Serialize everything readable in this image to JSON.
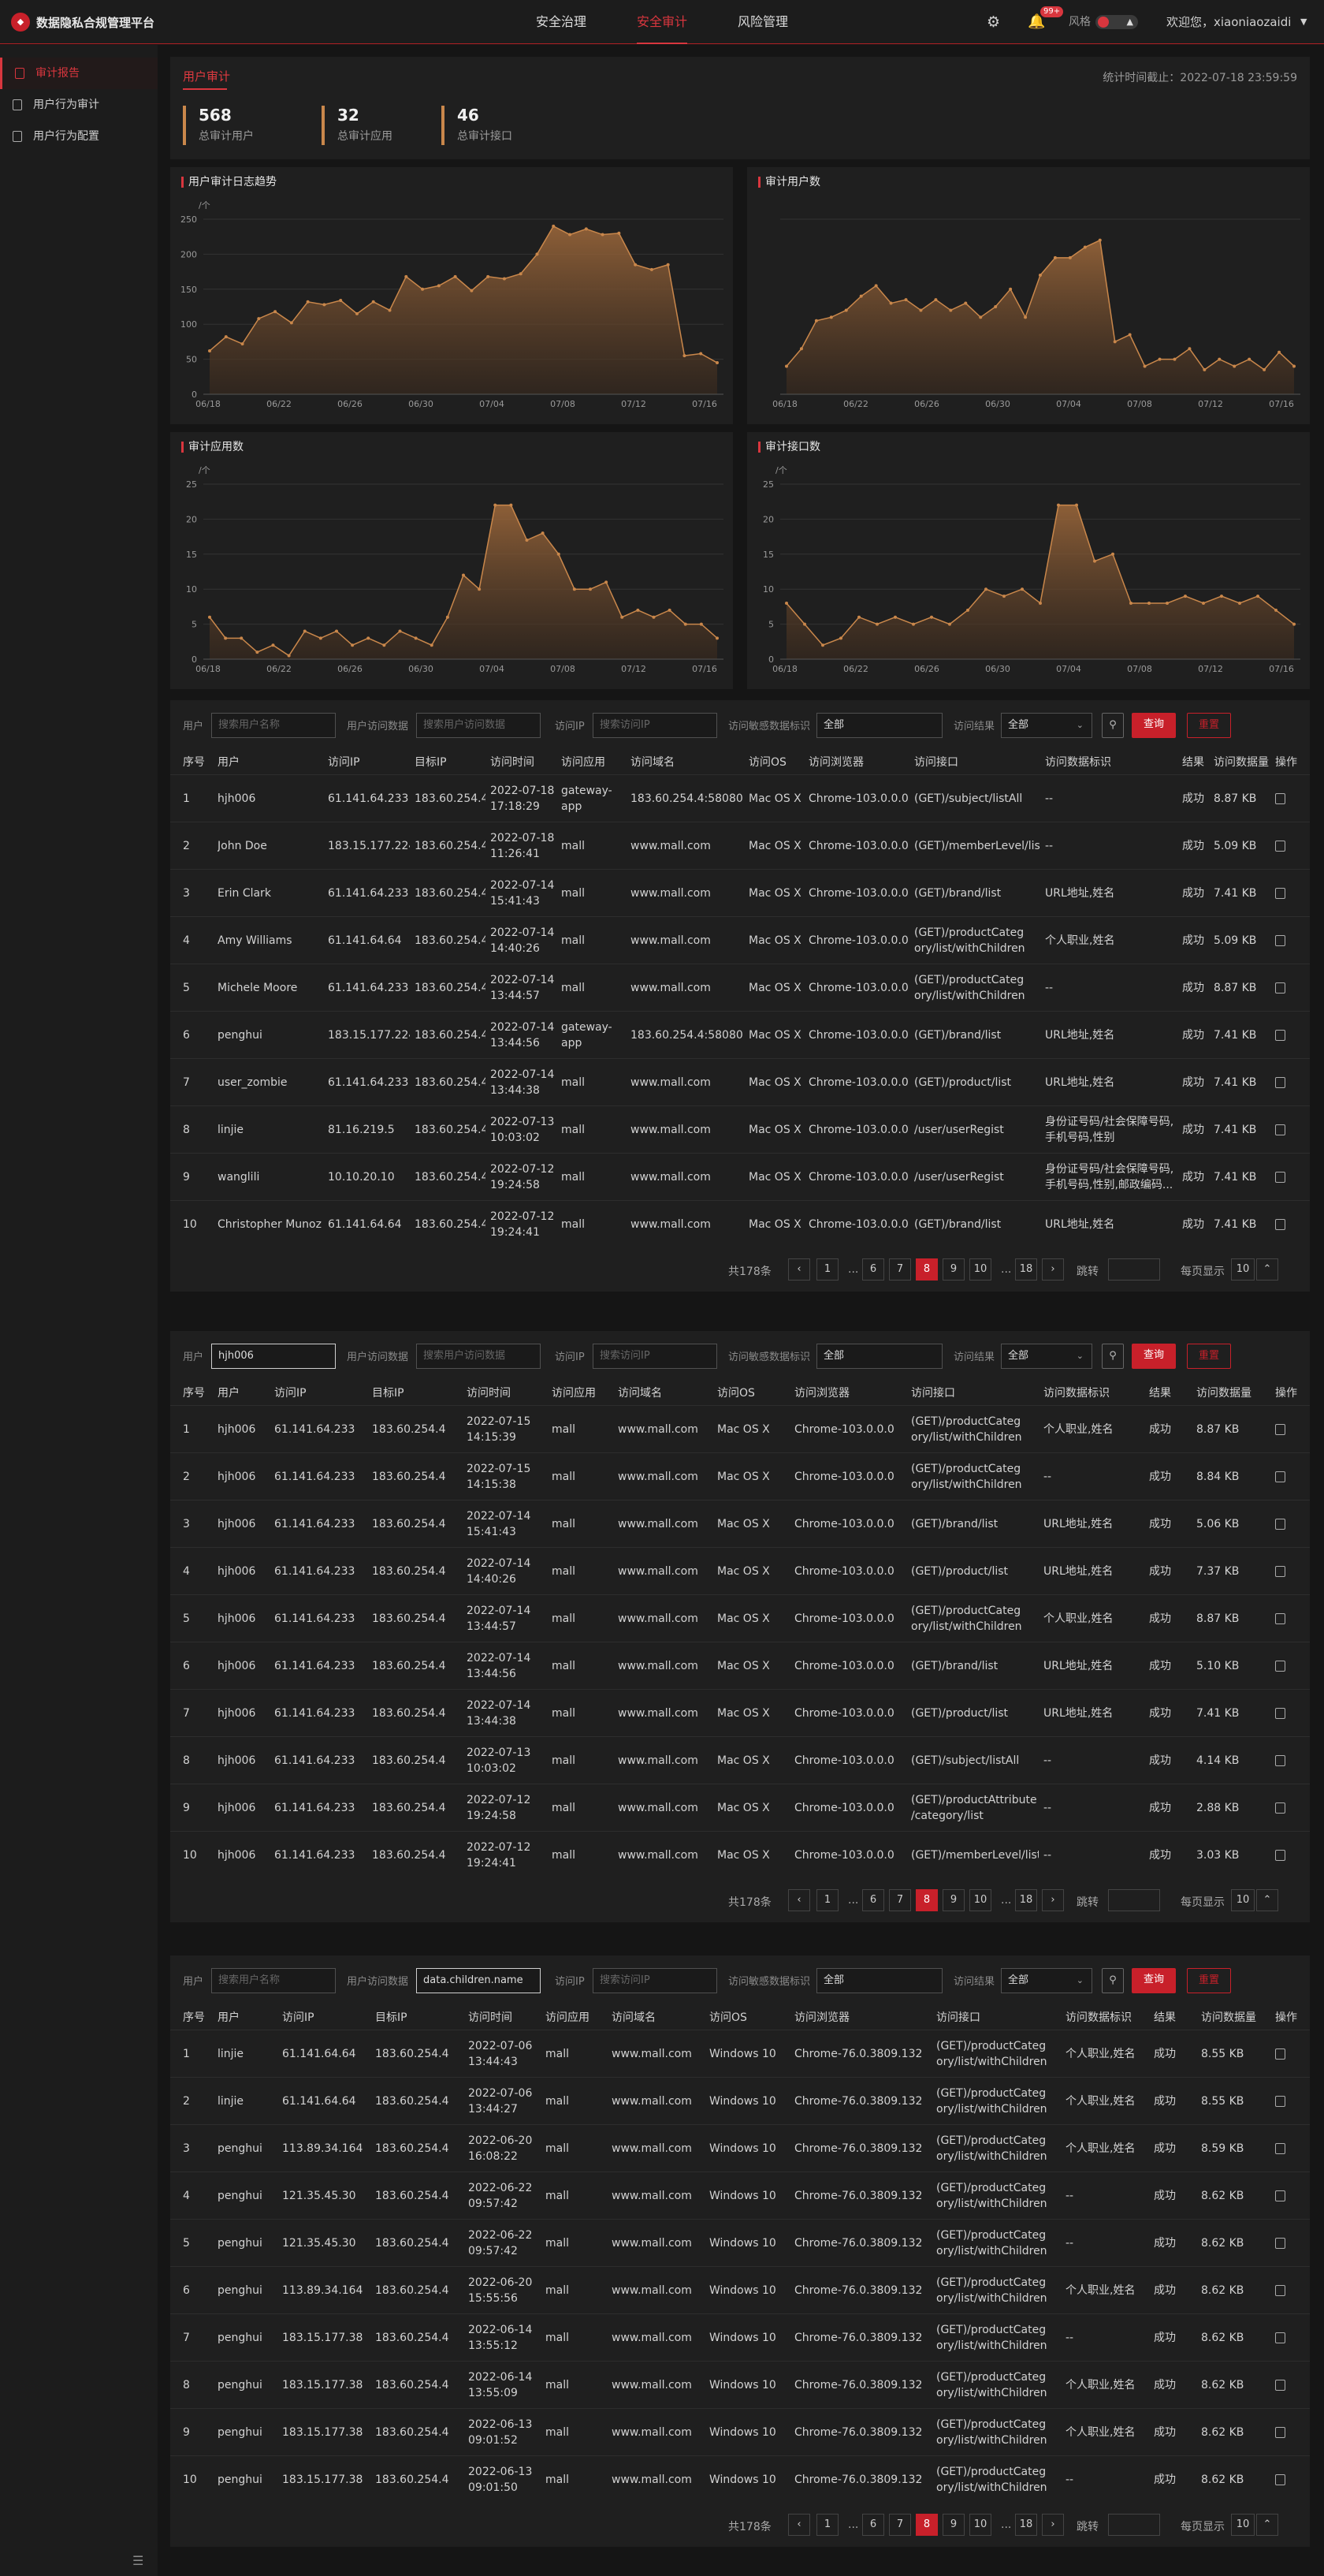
{
  "header": {
    "app_name": "数据隐私合规管理平台",
    "nav": [
      "安全治理",
      "安全审计",
      "风险管理"
    ],
    "badge": "99+",
    "style_label": "风格",
    "welcome": "欢迎您，xiaoniaozaidi"
  },
  "sidebar": {
    "items": [
      "审计报告",
      "用户行为审计",
      "用户行为配置"
    ]
  },
  "summary": {
    "title": "用户审计",
    "stamp": "统计时间截止：2022-07-18 23:59:59",
    "stats": [
      {
        "value": "568",
        "label": "总审计用户"
      },
      {
        "value": "32",
        "label": "总审计应用"
      },
      {
        "value": "46",
        "label": "总审计接口"
      }
    ]
  },
  "chart_data": [
    {
      "type": "area",
      "title": "用户审计日志趋势",
      "ylabel": "/个",
      "ylim": [
        0,
        250
      ],
      "yticks": [
        0,
        50,
        100,
        150,
        200,
        250
      ],
      "xticks": [
        "06/18",
        "06/22",
        "06/26",
        "06/30",
        "07/04",
        "07/08",
        "07/12",
        "07/16"
      ],
      "x_start": "06/17",
      "x_end": "07/17",
      "values": [
        62,
        82,
        72,
        108,
        118,
        102,
        132,
        128,
        134,
        115,
        132,
        120,
        168,
        150,
        155,
        168,
        148,
        168,
        165,
        172,
        200,
        240,
        228,
        236,
        228,
        230,
        185,
        178,
        185,
        55,
        58,
        45
      ]
    },
    {
      "type": "area",
      "title": "审计用户数",
      "ylabel": "",
      "ylim": [
        0,
        50
      ],
      "yticks": [],
      "xticks": [
        "06/18",
        "06/22",
        "06/26",
        "06/30",
        "07/04",
        "07/08",
        "07/12",
        "07/16"
      ],
      "x_start": "06/17",
      "x_end": "07/17",
      "values": [
        8,
        13,
        21,
        22,
        24,
        28,
        31,
        26,
        27,
        24,
        27,
        24,
        26,
        22,
        25,
        30,
        22,
        34,
        39,
        39,
        42,
        44,
        15,
        17,
        8,
        10,
        10,
        13,
        7,
        10,
        8,
        10,
        7,
        12,
        8
      ]
    },
    {
      "type": "area",
      "title": "审计应用数",
      "ylabel": "/个",
      "ylim": [
        0,
        25
      ],
      "yticks": [
        0,
        5,
        10,
        15,
        20,
        25
      ],
      "xticks": [
        "06/18",
        "06/22",
        "06/26",
        "06/30",
        "07/04",
        "07/08",
        "07/12",
        "07/16"
      ],
      "x_start": "06/17",
      "x_end": "07/17",
      "values": [
        6,
        3,
        3,
        1,
        2,
        0.5,
        4,
        3,
        4,
        2,
        3,
        2,
        4,
        3,
        2,
        6,
        12,
        10,
        22,
        22,
        17,
        18,
        15,
        10,
        10,
        11,
        6,
        7,
        6,
        7,
        5,
        5,
        3
      ]
    },
    {
      "type": "area",
      "title": "审计接口数",
      "ylabel": "/个",
      "ylim": [
        0,
        25
      ],
      "yticks": [
        0,
        5,
        10,
        15,
        20,
        25
      ],
      "xticks": [
        "06/18",
        "06/22",
        "06/26",
        "06/30",
        "07/04",
        "07/08",
        "07/12",
        "07/16"
      ],
      "x_start": "06/17",
      "x_end": "07/17",
      "values": [
        8,
        5,
        2,
        3,
        6,
        5,
        6,
        5,
        6,
        5,
        7,
        10,
        9,
        10,
        8,
        22,
        22,
        14,
        15,
        8,
        8,
        8,
        9,
        8,
        9,
        8,
        9,
        7,
        5
      ]
    }
  ],
  "tables": [
    {
      "filters": {
        "user_label": "用户",
        "user_placeholder": "搜索用户名称",
        "user_value": "",
        "data_label": "用户访问数据",
        "data_placeholder": "搜索用户访问数据",
        "data_value": "",
        "ip_label": "访问IP",
        "ip_placeholder": "搜索访问IP",
        "sens_label": "访问敏感数据标识",
        "sens_value": "全部",
        "result_label": "访问结果",
        "result_value": "全部",
        "query": "查询",
        "reset": "重置"
      },
      "columns": [
        "序号",
        "用户",
        "访问IP",
        "目标IP",
        "访问时间",
        "访问应用",
        "访问域名",
        "访问OS",
        "访问浏览器",
        "访问接口",
        "访问数据标识",
        "结果",
        "访问数据量",
        "操作"
      ],
      "rows": [
        [
          "1",
          "hjh006",
          "61.141.64.233",
          "183.60.254.4",
          "2022-07-18 17:18:29",
          "gateway-app",
          "183.60.254.4:58080",
          "Mac OS X",
          "Chrome-103.0.0.0",
          "(GET)/subject/listAll",
          "--",
          "成功",
          "8.87 KB"
        ],
        [
          "2",
          "John Doe",
          "183.15.177.224",
          "183.60.254.4",
          "2022-07-18 11:26:41",
          "mall",
          "www.mall.com",
          "Mac OS X",
          "Chrome-103.0.0.0",
          "(GET)/memberLevel/list",
          "--",
          "成功",
          "5.09 KB"
        ],
        [
          "3",
          "Erin Clark",
          "61.141.64.233",
          "183.60.254.4",
          "2022-07-14 15:41:43",
          "mall",
          "www.mall.com",
          "Mac OS X",
          "Chrome-103.0.0.0",
          "(GET)/brand/list",
          "URL地址,姓名",
          "成功",
          "7.41 KB"
        ],
        [
          "4",
          "Amy Williams",
          "61.141.64.64",
          "183.60.254.4",
          "2022-07-14 14:40:26",
          "mall",
          "www.mall.com",
          "Mac OS X",
          "Chrome-103.0.0.0",
          "(GET)/productCateg ory/list/withChildren",
          "个人职业,姓名",
          "成功",
          "5.09 KB"
        ],
        [
          "5",
          "Michele Moore",
          "61.141.64.233",
          "183.60.254.4",
          "2022-07-14 13:44:57",
          "mall",
          "www.mall.com",
          "Mac OS X",
          "Chrome-103.0.0.0",
          "(GET)/productCateg ory/list/withChildren",
          "--",
          "成功",
          "8.87 KB"
        ],
        [
          "6",
          "penghui",
          "183.15.177.224",
          "183.60.254.4",
          "2022-07-14 13:44:56",
          "gateway-app",
          "183.60.254.4:58080",
          "Mac OS X",
          "Chrome-103.0.0.0",
          "(GET)/brand/list",
          "URL地址,姓名",
          "成功",
          "7.41 KB"
        ],
        [
          "7",
          "user_zombie",
          "61.141.64.233",
          "183.60.254.4",
          "2022-07-14 13:44:38",
          "mall",
          "www.mall.com",
          "Mac OS X",
          "Chrome-103.0.0.0",
          "(GET)/product/list",
          "URL地址,姓名",
          "成功",
          "7.41 KB"
        ],
        [
          "8",
          "linjie",
          "81.16.219.5",
          "183.60.254.4",
          "2022-07-13 10:03:02",
          "mall",
          "www.mall.com",
          "Mac OS X",
          "Chrome-103.0.0.0",
          "/user/userRegist",
          "身份证号码/社会保障号码,手机号码,性别",
          "成功",
          "7.41 KB"
        ],
        [
          "9",
          "wanglili",
          "10.10.20.10",
          "183.60.254.4",
          "2022-07-12 19:24:58",
          "mall",
          "www.mall.com",
          "Mac OS X",
          "Chrome-103.0.0.0",
          "/user/userRegist",
          "身份证号码/社会保障号码,手机号码,性别,邮政编码...",
          "成功",
          "7.41 KB"
        ],
        [
          "10",
          "Christopher Munoz",
          "61.141.64.64",
          "183.60.254.4",
          "2022-07-12 19:24:41",
          "mall",
          "www.mall.com",
          "Mac OS X",
          "Chrome-103.0.0.0",
          "(GET)/brand/list",
          "URL地址,姓名",
          "成功",
          "7.41 KB"
        ]
      ],
      "pager": {
        "total": "共178条",
        "pages": [
          "1",
          "...",
          "6",
          "7",
          "8",
          "9",
          "10",
          "...",
          "18"
        ],
        "current": "8",
        "jump_label": "跳转",
        "size_label": "每页显示",
        "size": "10"
      }
    },
    {
      "filters": {
        "user_label": "用户",
        "user_placeholder": "搜索用户名称",
        "user_value": "hjh006",
        "data_label": "用户访问数据",
        "data_placeholder": "搜索用户访问数据",
        "data_value": "",
        "ip_label": "访问IP",
        "ip_placeholder": "搜索访问IP",
        "sens_label": "访问敏感数据标识",
        "sens_value": "全部",
        "result_label": "访问结果",
        "result_value": "全部",
        "query": "查询",
        "reset": "重置"
      },
      "columns": [
        "序号",
        "用户",
        "访问IP",
        "目标IP",
        "访问时间",
        "访问应用",
        "访问域名",
        "访问OS",
        "访问浏览器",
        "访问接口",
        "访问数据标识",
        "结果",
        "访问数据量",
        "操作"
      ],
      "rows": [
        [
          "1",
          "hjh006",
          "61.141.64.233",
          "183.60.254.4",
          "2022-07-15 14:15:39",
          "mall",
          "www.mall.com",
          "Mac OS X",
          "Chrome-103.0.0.0",
          "(GET)/productCateg ory/list/withChildren",
          "个人职业,姓名",
          "成功",
          "8.87 KB"
        ],
        [
          "2",
          "hjh006",
          "61.141.64.233",
          "183.60.254.4",
          "2022-07-15 14:15:38",
          "mall",
          "www.mall.com",
          "Mac OS X",
          "Chrome-103.0.0.0",
          "(GET)/productCateg ory/list/withChildren",
          "--",
          "成功",
          "8.84 KB"
        ],
        [
          "3",
          "hjh006",
          "61.141.64.233",
          "183.60.254.4",
          "2022-07-14 15:41:43",
          "mall",
          "www.mall.com",
          "Mac OS X",
          "Chrome-103.0.0.0",
          "(GET)/brand/list",
          "URL地址,姓名",
          "成功",
          "5.06 KB"
        ],
        [
          "4",
          "hjh006",
          "61.141.64.233",
          "183.60.254.4",
          "2022-07-14 14:40:26",
          "mall",
          "www.mall.com",
          "Mac OS X",
          "Chrome-103.0.0.0",
          "(GET)/product/list",
          "URL地址,姓名",
          "成功",
          "7.37 KB"
        ],
        [
          "5",
          "hjh006",
          "61.141.64.233",
          "183.60.254.4",
          "2022-07-14 13:44:57",
          "mall",
          "www.mall.com",
          "Mac OS X",
          "Chrome-103.0.0.0",
          "(GET)/productCateg ory/list/withChildren",
          "个人职业,姓名",
          "成功",
          "8.87 KB"
        ],
        [
          "6",
          "hjh006",
          "61.141.64.233",
          "183.60.254.4",
          "2022-07-14 13:44:56",
          "mall",
          "www.mall.com",
          "Mac OS X",
          "Chrome-103.0.0.0",
          "(GET)/brand/list",
          "URL地址,姓名",
          "成功",
          "5.10 KB"
        ],
        [
          "7",
          "hjh006",
          "61.141.64.233",
          "183.60.254.4",
          "2022-07-14 13:44:38",
          "mall",
          "www.mall.com",
          "Mac OS X",
          "Chrome-103.0.0.0",
          "(GET)/product/list",
          "URL地址,姓名",
          "成功",
          "7.41 KB"
        ],
        [
          "8",
          "hjh006",
          "61.141.64.233",
          "183.60.254.4",
          "2022-07-13 10:03:02",
          "mall",
          "www.mall.com",
          "Mac OS X",
          "Chrome-103.0.0.0",
          "(GET)/subject/listAll",
          "--",
          "成功",
          "4.14 KB"
        ],
        [
          "9",
          "hjh006",
          "61.141.64.233",
          "183.60.254.4",
          "2022-07-12 19:24:58",
          "mall",
          "www.mall.com",
          "Mac OS X",
          "Chrome-103.0.0.0",
          "(GET)/productAttribute /category/list",
          "--",
          "成功",
          "2.88 KB"
        ],
        [
          "10",
          "hjh006",
          "61.141.64.233",
          "183.60.254.4",
          "2022-07-12 19:24:41",
          "mall",
          "www.mall.com",
          "Mac OS X",
          "Chrome-103.0.0.0",
          "(GET)/memberLevel/list",
          "--",
          "成功",
          "3.03 KB"
        ]
      ],
      "pager": {
        "total": "共178条",
        "pages": [
          "1",
          "...",
          "6",
          "7",
          "8",
          "9",
          "10",
          "...",
          "18"
        ],
        "current": "8",
        "jump_label": "跳转",
        "size_label": "每页显示",
        "size": "10"
      }
    },
    {
      "filters": {
        "user_label": "用户",
        "user_placeholder": "搜索用户名称",
        "user_value": "",
        "data_label": "用户访问数据",
        "data_placeholder": "搜索用户访问数据",
        "data_value": "data.children.name",
        "ip_label": "访问IP",
        "ip_placeholder": "搜索访问IP",
        "sens_label": "访问敏感数据标识",
        "sens_value": "全部",
        "result_label": "访问结果",
        "result_value": "全部",
        "query": "查询",
        "reset": "重置"
      },
      "columns": [
        "序号",
        "用户",
        "访问IP",
        "目标IP",
        "访问时间",
        "访问应用",
        "访问域名",
        "访问OS",
        "访问浏览器",
        "访问接口",
        "访问数据标识",
        "结果",
        "访问数据量",
        "操作"
      ],
      "rows": [
        [
          "1",
          "linjie",
          "61.141.64.64",
          "183.60.254.4",
          "2022-07-06 13:44:43",
          "mall",
          "www.mall.com",
          "Windows 10",
          "Chrome-76.0.3809.132",
          "(GET)/productCateg ory/list/withChildren",
          "个人职业,姓名",
          "成功",
          "8.55 KB"
        ],
        [
          "2",
          "linjie",
          "61.141.64.64",
          "183.60.254.4",
          "2022-07-06 13:44:27",
          "mall",
          "www.mall.com",
          "Windows 10",
          "Chrome-76.0.3809.132",
          "(GET)/productCateg ory/list/withChildren",
          "个人职业,姓名",
          "成功",
          "8.55 KB"
        ],
        [
          "3",
          "penghui",
          "113.89.34.164",
          "183.60.254.4",
          "2022-06-20 16:08:22",
          "mall",
          "www.mall.com",
          "Windows 10",
          "Chrome-76.0.3809.132",
          "(GET)/productCateg ory/list/withChildren",
          "个人职业,姓名",
          "成功",
          "8.59 KB"
        ],
        [
          "4",
          "penghui",
          "121.35.45.30",
          "183.60.254.4",
          "2022-06-22 09:57:42",
          "mall",
          "www.mall.com",
          "Windows 10",
          "Chrome-76.0.3809.132",
          "(GET)/productCateg ory/list/withChildren",
          "--",
          "成功",
          "8.62 KB"
        ],
        [
          "5",
          "penghui",
          "121.35.45.30",
          "183.60.254.4",
          "2022-06-22 09:57:42",
          "mall",
          "www.mall.com",
          "Windows 10",
          "Chrome-76.0.3809.132",
          "(GET)/productCateg ory/list/withChildren",
          "--",
          "成功",
          "8.62 KB"
        ],
        [
          "6",
          "penghui",
          "113.89.34.164",
          "183.60.254.4",
          "2022-06-20 15:55:56",
          "mall",
          "www.mall.com",
          "Windows 10",
          "Chrome-76.0.3809.132",
          "(GET)/productCateg ory/list/withChildren",
          "个人职业,姓名",
          "成功",
          "8.62 KB"
        ],
        [
          "7",
          "penghui",
          "183.15.177.38",
          "183.60.254.4",
          "2022-06-14 13:55:12",
          "mall",
          "www.mall.com",
          "Windows 10",
          "Chrome-76.0.3809.132",
          "(GET)/productCateg ory/list/withChildren",
          "--",
          "成功",
          "8.62 KB"
        ],
        [
          "8",
          "penghui",
          "183.15.177.38",
          "183.60.254.4",
          "2022-06-14 13:55:09",
          "mall",
          "www.mall.com",
          "Windows 10",
          "Chrome-76.0.3809.132",
          "(GET)/productCateg ory/list/withChildren",
          "个人职业,姓名",
          "成功",
          "8.62 KB"
        ],
        [
          "9",
          "penghui",
          "183.15.177.38",
          "183.60.254.4",
          "2022-06-13 09:01:52",
          "mall",
          "www.mall.com",
          "Windows 10",
          "Chrome-76.0.3809.132",
          "(GET)/productCateg ory/list/withChildren",
          "个人职业,姓名",
          "成功",
          "8.62 KB"
        ],
        [
          "10",
          "penghui",
          "183.15.177.38",
          "183.60.254.4",
          "2022-06-13 09:01:50",
          "mall",
          "www.mall.com",
          "Windows 10",
          "Chrome-76.0.3809.132",
          "(GET)/productCateg ory/list/withChildren",
          "--",
          "成功",
          "8.62 KB"
        ]
      ],
      "pager": {
        "total": "共178条",
        "pages": [
          "1",
          "...",
          "6",
          "7",
          "8",
          "9",
          "10",
          "...",
          "18"
        ],
        "current": "8",
        "jump_label": "跳转",
        "size_label": "每页显示",
        "size": "10"
      }
    }
  ]
}
